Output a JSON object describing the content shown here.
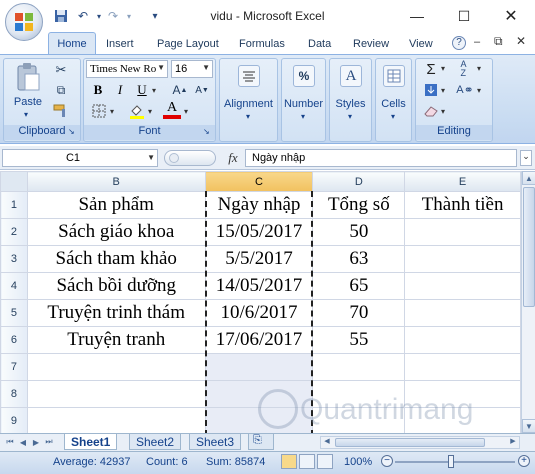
{
  "window": {
    "title": "vidu - Microsoft Excel"
  },
  "qat": {
    "save_icon": "save-icon",
    "undo_icon": "undo-icon",
    "redo_icon": "redo-icon"
  },
  "tabs": [
    "Home",
    "Insert",
    "Page Layout",
    "Formulas",
    "Data",
    "Review",
    "View"
  ],
  "ribbon": {
    "clipboard": {
      "paste_label": "Paste",
      "group_label": "Clipboard"
    },
    "font": {
      "name": "Times New Ro",
      "size": "16",
      "bold": "B",
      "italic": "I",
      "underline": "U",
      "color_letter": "A",
      "group_label": "Font"
    },
    "alignment_label": "Alignment",
    "number_label": "Number",
    "number_symbol": "%",
    "styles_label": "Styles",
    "styles_symbol": "A",
    "cells_label": "Cells",
    "editing": {
      "group_label": "Editing",
      "sigma": "Σ",
      "sort": "A Z",
      "find": "A"
    }
  },
  "formula_bar": {
    "name_box": "C1",
    "fx": "fx",
    "value": "Ngày nhập"
  },
  "sheet": {
    "columns": [
      "B",
      "C",
      "D",
      "E"
    ],
    "selected_column": "C",
    "row_numbers": [
      "1",
      "2",
      "3",
      "4",
      "5",
      "6",
      "7",
      "8",
      "9"
    ],
    "rows": [
      [
        "Sản phẩm",
        "Ngày nhập",
        "Tổng số",
        "Thành tiền"
      ],
      [
        "Sách giáo khoa",
        "15/05/2017",
        "50",
        ""
      ],
      [
        "Sách tham khảo",
        "5/5/2017",
        "63",
        ""
      ],
      [
        "Sách bồi dưỡng",
        "14/05/2017",
        "65",
        ""
      ],
      [
        "Truyện trinh thám",
        "10/6/2017",
        "70",
        ""
      ],
      [
        "Truyện tranh",
        "17/06/2017",
        "55",
        ""
      ],
      [
        "",
        "",
        "",
        ""
      ],
      [
        "",
        "",
        "",
        ""
      ],
      [
        "",
        "",
        "",
        ""
      ]
    ]
  },
  "sheet_tabs": [
    "Sheet1",
    "Sheet2",
    "Sheet3"
  ],
  "active_sheet": "Sheet1",
  "status": {
    "average": "Average: 42937",
    "count": "Count: 6",
    "sum": "Sum: 85874",
    "zoom": "100%"
  },
  "watermark": "Quantrimang",
  "colors": {
    "accent": "#15428b",
    "ribbon": "#c9dcf2",
    "selected_header": "#f1c15f",
    "selected_col": "#e8ecf6"
  }
}
